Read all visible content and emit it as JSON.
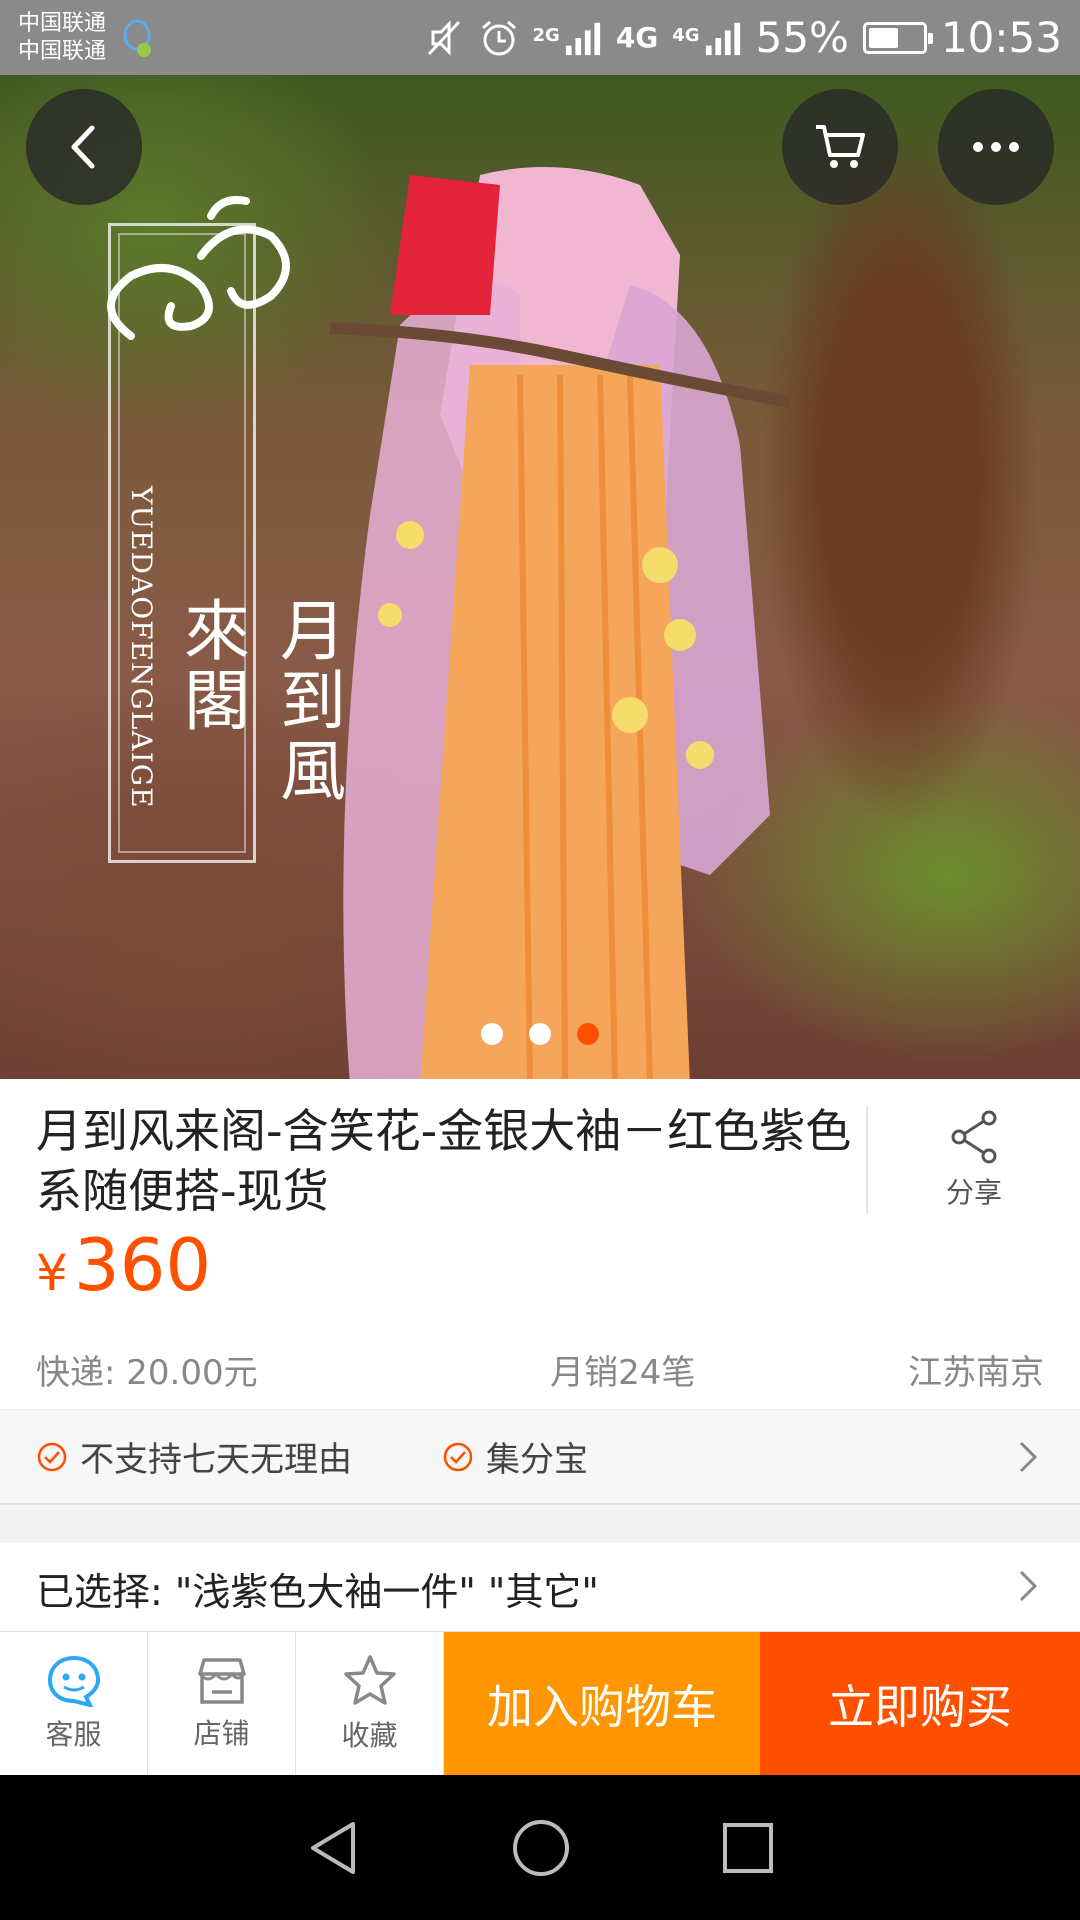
{
  "status_bar": {
    "carrier_1": "中国联通",
    "carrier_2": "中国联通",
    "net_2g": "2G",
    "net_4g_a": "4G",
    "net_4g_b": "4G",
    "battery": "55%",
    "battery_level": 0.55,
    "time": "10:53"
  },
  "hero": {
    "brand_latin": "YUEDAOFENGLAIGE",
    "brand_chinese": "月到風來閣",
    "slide_count": 3,
    "active_slide": 3
  },
  "product": {
    "title": "月到风来阁-含笑花-金银大袖－红色紫色系随便搭-现货",
    "share_label": "分享",
    "price_symbol": "¥",
    "price": "360",
    "shipping": "快递: 20.00元",
    "monthly_sales": "月销24笔",
    "location": "江苏南京"
  },
  "services": {
    "items": [
      "不支持七天无理由",
      "集分宝"
    ]
  },
  "selection": {
    "text": "已选择: \"浅紫色大袖一件\" \"其它\""
  },
  "bottom_bar": {
    "service_label": "客服",
    "shop_label": "店铺",
    "favorite_label": "收藏",
    "add_to_cart": "加入购物车",
    "buy_now": "立即购买"
  },
  "colors": {
    "accent_orange": "#ff5000",
    "cart_orange": "#ff9500",
    "service_blue": "#2ca7f3"
  }
}
